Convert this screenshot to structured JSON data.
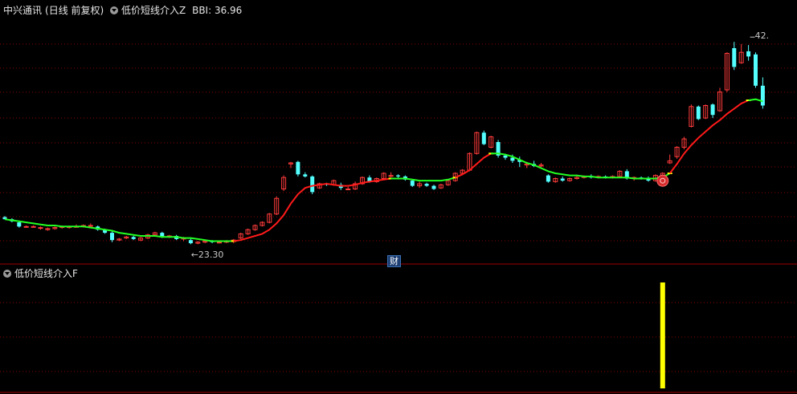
{
  "header": {
    "stock_name": "中兴通讯",
    "period": "(日线 前复权)",
    "indicator": "低价短线介入Z",
    "bbi_label": "BBI: 36.96"
  },
  "lower_header": {
    "indicator": "低价短线介入F"
  },
  "badges": {
    "finance": "财"
  },
  "annotations": {
    "low_label": "←23.30",
    "high_label": "42."
  },
  "colors": {
    "background": "#000000",
    "up_candle": "#ff3b3b",
    "down_candle": "#54ffff",
    "bbi_green": "#22ff22",
    "bbi_red": "#ff1a1a",
    "bbi_yellow": "#ffff00",
    "signal_bar": "#ffff00",
    "grid": "#8b0000",
    "panel_border": "#a00000"
  },
  "chart_data": [
    {
      "type": "candlestick",
      "title": "低价短线介入Z",
      "ylim": [
        22,
        44
      ],
      "ohlc": [
        [
          25.8,
          25.9,
          25.6,
          25.6
        ],
        [
          25.6,
          25.7,
          25.3,
          25.4
        ],
        [
          25.3,
          25.4,
          24.8,
          24.9
        ],
        [
          24.9,
          25.0,
          24.8,
          24.9
        ],
        [
          24.9,
          25.0,
          24.8,
          24.9
        ],
        [
          24.8,
          24.9,
          24.6,
          24.8
        ],
        [
          24.6,
          24.8,
          24.5,
          24.7
        ],
        [
          24.7,
          24.9,
          24.6,
          24.8
        ],
        [
          24.8,
          25.0,
          24.7,
          24.9
        ],
        [
          24.8,
          25.0,
          24.7,
          24.9
        ],
        [
          24.9,
          25.1,
          24.8,
          24.9
        ],
        [
          24.9,
          25.1,
          24.8,
          25.0
        ],
        [
          25.0,
          25.2,
          24.9,
          25.0
        ],
        [
          24.9,
          25.0,
          24.5,
          24.6
        ],
        [
          24.6,
          24.7,
          24.2,
          24.3
        ],
        [
          24.3,
          24.5,
          23.4,
          23.6
        ],
        [
          23.6,
          23.8,
          23.5,
          23.7
        ],
        [
          23.8,
          24.0,
          23.7,
          23.9
        ],
        [
          23.9,
          24.0,
          23.6,
          23.7
        ],
        [
          23.6,
          23.9,
          23.5,
          23.8
        ],
        [
          23.8,
          24.2,
          23.7,
          24.1
        ],
        [
          24.1,
          24.4,
          24.0,
          24.3
        ],
        [
          24.3,
          24.4,
          23.8,
          23.9
        ],
        [
          23.9,
          24.1,
          23.8,
          24.0
        ],
        [
          24.0,
          24.1,
          23.6,
          23.7
        ],
        [
          23.7,
          23.9,
          23.5,
          23.8
        ],
        [
          23.6,
          23.8,
          23.2,
          23.3
        ],
        [
          23.3,
          23.5,
          23.2,
          23.4
        ],
        [
          23.4,
          23.6,
          23.3,
          23.5
        ],
        [
          23.5,
          23.6,
          23.3,
          23.4
        ],
        [
          23.4,
          23.5,
          23.3,
          23.4
        ],
        [
          23.4,
          23.6,
          23.3,
          23.5
        ],
        [
          23.5,
          23.7,
          23.3,
          23.6
        ],
        [
          23.8,
          24.3,
          23.7,
          24.2
        ],
        [
          24.2,
          24.7,
          24.1,
          24.6
        ],
        [
          24.6,
          25.1,
          24.5,
          25.0
        ],
        [
          25.0,
          25.4,
          24.9,
          25.3
        ],
        [
          25.3,
          26.2,
          25.2,
          26.1
        ],
        [
          26.1,
          27.8,
          26.0,
          27.6
        ],
        [
          28.5,
          29.8,
          28.3,
          29.6
        ],
        [
          30.9,
          31.1,
          30.5,
          31.0
        ],
        [
          31.1,
          31.2,
          29.7,
          29.9
        ],
        [
          29.9,
          30.1,
          29.6,
          29.7
        ],
        [
          29.7,
          29.8,
          28.0,
          28.2
        ],
        [
          28.6,
          29.1,
          28.5,
          29.0
        ],
        [
          29.0,
          29.1,
          28.8,
          28.9
        ],
        [
          28.9,
          29.4,
          28.8,
          29.3
        ],
        [
          28.9,
          29.1,
          28.4,
          28.6
        ],
        [
          28.5,
          28.7,
          28.4,
          28.5
        ],
        [
          28.5,
          29.2,
          28.4,
          29.0
        ],
        [
          29.0,
          29.7,
          28.9,
          29.6
        ],
        [
          29.6,
          29.8,
          29.1,
          29.2
        ],
        [
          29.2,
          29.6,
          29.1,
          29.5
        ],
        [
          29.5,
          30.1,
          29.4,
          30.0
        ],
        [
          29.7,
          30.1,
          29.6,
          29.8
        ],
        [
          29.8,
          29.9,
          29.5,
          29.7
        ],
        [
          29.7,
          29.8,
          29.3,
          29.4
        ],
        [
          29.3,
          29.4,
          28.7,
          28.8
        ],
        [
          28.8,
          29.2,
          28.6,
          29.0
        ],
        [
          29.0,
          29.1,
          28.7,
          28.8
        ],
        [
          28.8,
          28.9,
          28.4,
          28.5
        ],
        [
          28.6,
          29.0,
          28.5,
          28.9
        ],
        [
          28.9,
          29.4,
          28.8,
          29.3
        ],
        [
          29.3,
          30.1,
          29.2,
          30.0
        ],
        [
          30.0,
          30.4,
          29.9,
          30.3
        ],
        [
          30.3,
          32.0,
          30.2,
          31.9
        ],
        [
          31.9,
          34.0,
          31.8,
          33.9
        ],
        [
          33.9,
          34.1,
          32.7,
          32.8
        ],
        [
          32.5,
          33.6,
          32.4,
          33.5
        ],
        [
          33.0,
          33.2,
          31.5,
          31.7
        ],
        [
          31.7,
          31.8,
          31.3,
          31.5
        ],
        [
          31.5,
          31.8,
          31.0,
          31.2
        ],
        [
          31.3,
          31.6,
          30.6,
          31.1
        ],
        [
          30.8,
          31.1,
          30.5,
          30.9
        ],
        [
          30.9,
          31.2,
          30.6,
          30.7
        ],
        [
          30.7,
          31.0,
          30.6,
          30.8
        ],
        [
          29.8,
          29.9,
          29.1,
          29.2
        ],
        [
          29.2,
          29.6,
          29.1,
          29.5
        ],
        [
          29.5,
          29.7,
          29.2,
          29.3
        ],
        [
          29.3,
          29.6,
          29.2,
          29.5
        ],
        [
          29.5,
          29.8,
          29.4,
          29.6
        ],
        [
          29.6,
          29.8,
          29.5,
          29.7
        ],
        [
          29.7,
          29.9,
          29.5,
          29.6
        ],
        [
          29.6,
          29.8,
          29.5,
          29.7
        ],
        [
          29.7,
          29.8,
          29.5,
          29.6
        ],
        [
          29.6,
          29.8,
          29.5,
          29.7
        ],
        [
          29.7,
          30.3,
          29.6,
          30.2
        ],
        [
          30.2,
          30.4,
          29.4,
          29.5
        ],
        [
          29.5,
          29.7,
          29.3,
          29.6
        ],
        [
          29.6,
          29.7,
          29.4,
          29.5
        ],
        [
          29.5,
          29.7,
          29.2,
          29.3
        ],
        [
          29.3,
          29.9,
          29.2,
          29.8
        ],
        [
          29.8,
          30.1,
          29.7,
          30.0
        ],
        [
          31.0,
          31.8,
          30.9,
          31.2
        ],
        [
          31.6,
          32.6,
          31.4,
          32.5
        ],
        [
          32.5,
          33.5,
          32.3,
          33.3
        ],
        [
          34.5,
          36.6,
          34.4,
          36.4
        ],
        [
          36.4,
          36.5,
          35.1,
          35.2
        ],
        [
          35.3,
          36.6,
          35.2,
          36.5
        ],
        [
          36.6,
          36.7,
          35.3,
          35.6
        ],
        [
          36.0,
          38.2,
          35.9,
          37.8
        ],
        [
          38.0,
          41.6,
          37.8,
          41.5
        ],
        [
          42.0,
          42.6,
          39.9,
          40.2
        ],
        [
          40.6,
          42.4,
          40.5,
          41.6
        ],
        [
          41.7,
          42.3,
          40.8,
          41.2
        ],
        [
          41.4,
          41.6,
          38.2,
          38.4
        ],
        [
          38.4,
          39.2,
          36.2,
          36.5
        ]
      ],
      "bbi": [
        25.6,
        25.5,
        25.4,
        25.3,
        25.2,
        25.1,
        25.0,
        25.0,
        24.9,
        24.9,
        24.9,
        24.9,
        24.8,
        24.7,
        24.6,
        24.5,
        24.3,
        24.2,
        24.1,
        24.0,
        24.0,
        24.0,
        23.9,
        23.9,
        23.9,
        23.8,
        23.8,
        23.7,
        23.6,
        23.5,
        23.5,
        23.5,
        23.5,
        23.6,
        23.8,
        24.0,
        24.2,
        24.6,
        25.2,
        26.0,
        27.1,
        28.0,
        28.6,
        28.8,
        28.9,
        29.0,
        28.9,
        28.8,
        28.8,
        28.9,
        29.1,
        29.2,
        29.3,
        29.4,
        29.5,
        29.5,
        29.5,
        29.4,
        29.3,
        29.3,
        29.3,
        29.3,
        29.4,
        29.6,
        29.9,
        30.3,
        30.9,
        31.5,
        31.9,
        31.9,
        31.8,
        31.6,
        31.3,
        31.0,
        30.8,
        30.5,
        30.2,
        30.0,
        29.9,
        29.8,
        29.8,
        29.7,
        29.7,
        29.6,
        29.6,
        29.6,
        29.6,
        29.6,
        29.5,
        29.5,
        29.5,
        29.5,
        29.6,
        30.0,
        30.9,
        31.9,
        32.7,
        33.4,
        34.0,
        34.6,
        35.1,
        35.7,
        36.2,
        36.7,
        37.0,
        37.1,
        36.9
      ],
      "bbi_color_segments": [
        {
          "from": 0,
          "to": 32,
          "color": "green"
        },
        {
          "from": 32,
          "to": 54,
          "color": "red"
        },
        {
          "from": 54,
          "to": 63,
          "color": "green"
        },
        {
          "from": 63,
          "to": 68,
          "color": "red"
        },
        {
          "from": 68,
          "to": 93,
          "color": "green"
        },
        {
          "from": 93,
          "to": 104,
          "color": "red"
        },
        {
          "from": 104,
          "to": 107,
          "color": "green"
        }
      ],
      "marker_low": {
        "index": 33,
        "value": 23.3
      },
      "marker_high": {
        "index": 104,
        "value": 42.6
      },
      "signal_marker": {
        "index": 92
      }
    },
    {
      "type": "bar",
      "title": "低价短线介入F",
      "signal_index": 92,
      "signal_value": 1
    }
  ]
}
